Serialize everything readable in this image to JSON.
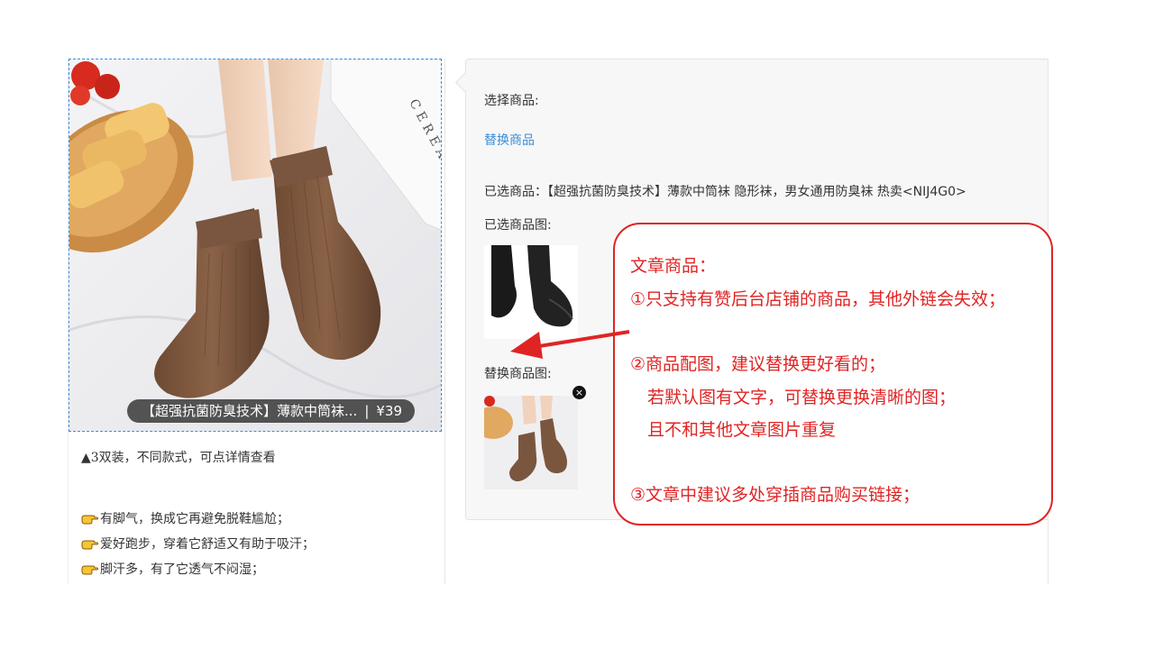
{
  "product": {
    "title": "【超强抗菌防臭技术】薄款中筒袜...",
    "separator": "|",
    "price": "¥39"
  },
  "article": {
    "lines": [
      "▲3双装，不同款式，可点详情查看",
      "有脚气，换成它再避免脱鞋尴尬；",
      "爱好跑步，穿着它舒适又有助于吸汗；",
      "脚汗多，有了它透气不闷湿；"
    ]
  },
  "panel": {
    "select_label": "选择商品:",
    "replace_link": "替换商品",
    "selected_product": "已选商品：【超强抗菌防臭技术】薄款中筒袜 隐形袜，男女通用防臭袜 热卖<NIJ4G0>",
    "selected_image_label": "已选商品图:",
    "replace_image_label": "替换商品图:",
    "close_glyph": "×"
  },
  "annotation": {
    "title": "文章商品：",
    "point1": "①只支持有赞后台店铺的商品，其他外链会失效；",
    "point2": "②商品配图，建议替换更好看的；",
    "point2a": "若默认图有文字，可替换更换清晰的图；",
    "point2b": "且不和其他文章图片重复",
    "point3": "③文章中建议多处穿插商品购买链接；"
  },
  "colors": {
    "annotation_red": "#e02424",
    "link_blue": "#3a8ed8",
    "selection_blue": "#3b8de0"
  }
}
